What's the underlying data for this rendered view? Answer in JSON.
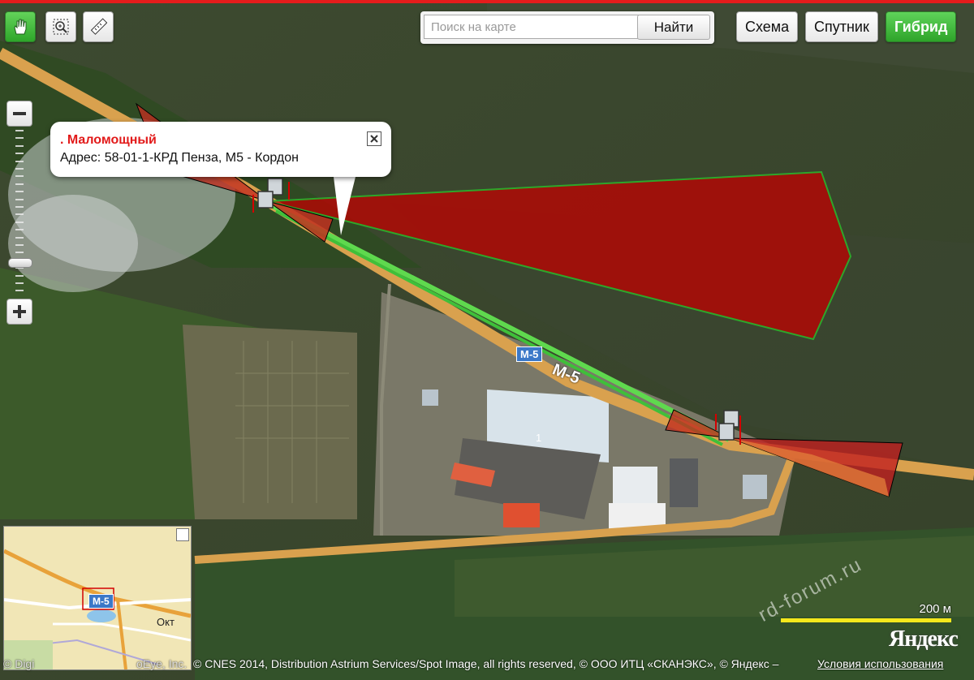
{
  "toolbar": {
    "search_placeholder": "Поиск на карте",
    "search_button": "Найти",
    "layers": [
      "Схема",
      "Спутник",
      "Гибрид"
    ],
    "active_layer": "Гибрид",
    "tools": [
      "hand-icon",
      "zoom-select-icon",
      "ruler-icon"
    ],
    "active_tool": "hand-icon"
  },
  "zoom": {
    "minus": "−",
    "plus": "+",
    "level_fraction": 0.8
  },
  "balloon": {
    "title": ". Маломощный",
    "address": "Адрес: 58-01-1-КРД Пенза, М5 - Кордон",
    "close_icon": "close-icon"
  },
  "map_labels": {
    "road_sign": "М-5",
    "road_name": "М-5",
    "building_number": "1"
  },
  "minimap": {
    "road_sign": "М-5",
    "place_label": "Окт"
  },
  "scale": {
    "label": "200 м"
  },
  "logo": "Яндекс",
  "watermark": "rd-forum.ru",
  "copyright": {
    "left": "© Digi",
    "left2": "oEye, Inc.",
    "text": "© CNES 2014, Distribution Astrium Services/Spot Image, all rights reserved, © ООО ИТЦ «СКАНЭКС», © Яндекс –",
    "terms": "Условия использования"
  },
  "colors": {
    "accent_green": "#2ea62a",
    "zone_red": "#c00000",
    "route_green": "#5fd94e",
    "topline": "#e51c1c"
  }
}
